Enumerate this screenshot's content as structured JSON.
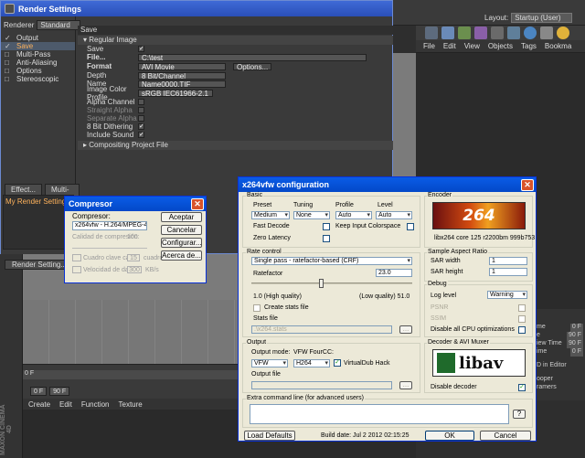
{
  "c4d": {
    "layout_label": "Layout:",
    "layout_value": "Startup (User)",
    "object_menu": [
      "File",
      "Edit",
      "View",
      "Objects",
      "Tags",
      "Bookma"
    ],
    "material_menu": [
      "Create",
      "Edit",
      "Function",
      "Texture"
    ],
    "timeline": {
      "start": "0 F",
      "current": "0 F",
      "end": "90 F"
    },
    "attributes": [
      {
        "label": "me",
        "value": "0 F"
      },
      {
        "label": "e",
        "value": "90 F"
      },
      {
        "label": "iew Time",
        "value": "90 F"
      },
      {
        "label": "ime",
        "value": "0 F"
      },
      {
        "label": "D in Editor",
        "value": ""
      },
      {
        "label": "ooper",
        "value": ""
      },
      {
        "label": "ramers",
        "value": ""
      }
    ],
    "brand": "MAXON CINEMA 4D"
  },
  "render_settings": {
    "title": "Render Settings",
    "renderer_label": "Renderer",
    "renderer_value": "Standard",
    "sections": [
      {
        "label": "Output",
        "checked": true,
        "selected": false
      },
      {
        "label": "Save",
        "checked": true,
        "selected": true
      },
      {
        "label": "Multi-Pass",
        "checked": false,
        "selected": false
      },
      {
        "label": "Anti-Aliasing",
        "checked": false,
        "selected": false
      },
      {
        "label": "Options",
        "checked": false,
        "selected": false
      },
      {
        "label": "Stereoscopic",
        "checked": false,
        "selected": false
      }
    ],
    "effect_button": "Effect...",
    "multipass_button": "Multi-Pass...",
    "my_settings": "My Render Setting",
    "render_setting_button": "Render Setting...",
    "save_header": "Save",
    "regular_header": "Regular Image",
    "compositing_header": "Compositing Project File",
    "fields": {
      "save_label": "Save",
      "file_label": "File...",
      "file_value": "C:\\test",
      "format_label": "Format",
      "format_value": "AVI Movie",
      "options_button": "Options...",
      "depth_label": "Depth",
      "depth_value": "8 Bit/Channel",
      "name_label": "Name",
      "name_value": "Name0000.TIF",
      "profile_label": "Image Color Profile",
      "profile_value": "sRGB IEC61966-2.1",
      "alpha_label": "Alpha Channel",
      "straight_label": "Straight Alpha",
      "separate_label": "Separate Alpha",
      "dither_label": "8 Bit Dithering",
      "sound_label": "Include Sound"
    }
  },
  "compressor": {
    "title": "Compresor",
    "label": "Compresor:",
    "selected": "x264vfw - H.264/MPEG-4 AVC codec",
    "quality_label": "Calidad de compresión:",
    "quality_value": "100",
    "keyframe_label": "Cuadro clave cada",
    "keyframe_value": "15",
    "keyframe_unit": "cuadros",
    "rate_label": "Velocidad de datos",
    "rate_value": "300",
    "rate_unit": "KB/s",
    "buttons": {
      "accept": "Aceptar",
      "cancel": "Cancelar",
      "configure": "Configurar...",
      "about": "Acerca de..."
    }
  },
  "x264": {
    "title": "x264vfw configuration",
    "basic": {
      "group": "Basic",
      "preset_label": "Preset",
      "preset_value": "Medium",
      "tuning_label": "Tuning",
      "tuning_value": "None",
      "profile_label": "Profile",
      "profile_value": "Auto",
      "level_label": "Level",
      "level_value": "Auto",
      "fast_decode": "Fast Decode",
      "keep_input": "Keep Input Colorspace",
      "zero_latency": "Zero Latency"
    },
    "encoder": {
      "group": "Encoder",
      "logo_text": "264",
      "version": "libx264 core 125 r2200bm 999b753"
    },
    "rate_control": {
      "group": "Rate control",
      "mode": "Single pass - ratefactor-based (CRF)",
      "ratefactor_label": "Ratefactor",
      "ratefactor_value": "23.0",
      "high_quality": "1.0 (High quality)",
      "low_quality": "(Low quality) 51.0",
      "slider_pct": 0.43,
      "create_stats": "Create stats file",
      "stats_label": "Stats file",
      "stats_value": ".\\x264.stats"
    },
    "sar": {
      "group": "Sample Aspect Ratio",
      "width_label": "SAR width",
      "width_value": "1",
      "height_label": "SAR height",
      "height_value": "1"
    },
    "debug": {
      "group": "Debug",
      "log_label": "Log level",
      "log_value": "Warning",
      "psnr": "PSNR",
      "ssim": "SSIM",
      "disable_cpu": "Disable all CPU optimizations"
    },
    "output": {
      "group": "Output",
      "mode_label": "Output mode:",
      "mode_value": "VFW",
      "fourcc_label": "VFW FourCC:",
      "fourcc_value": "H264",
      "virtualdub": "VirtualDub Hack",
      "file_label": "Output file"
    },
    "muxer": {
      "group": "Decoder & AVI Muxer",
      "logo_text": "libav",
      "disable_decoder": "Disable decoder"
    },
    "extra": {
      "group": "Extra command line (for advanced users)",
      "help_button": "?"
    },
    "buttons": {
      "load_defaults": "Load Defaults",
      "build_date": "Build date: Jul  2 2012 02:15:25",
      "ok": "OK",
      "cancel": "Cancel"
    }
  }
}
